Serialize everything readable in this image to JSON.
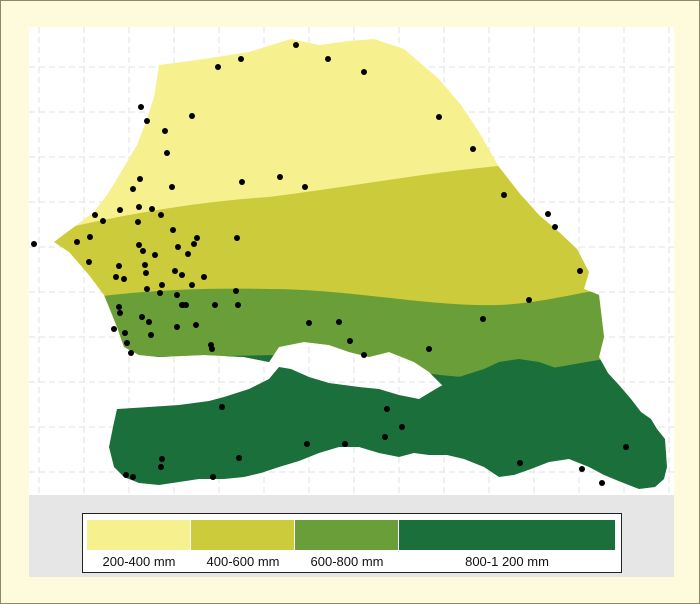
{
  "map": {
    "zones": [
      {
        "id": "zone-200-400",
        "color": "#f7f08f"
      },
      {
        "id": "zone-400-600",
        "color": "#cccb3b"
      },
      {
        "id": "zone-600-800",
        "color": "#6a9e38"
      },
      {
        "id": "zone-800-1200",
        "color": "#1a6f3a"
      }
    ],
    "point_color": "#000000"
  },
  "legend": {
    "items": [
      {
        "label": "200-400 mm",
        "color": "#f7f08f"
      },
      {
        "label": "400-600 mm",
        "color": "#cccb3b"
      },
      {
        "label": "600-800 mm",
        "color": "#6a9e38"
      },
      {
        "label": "800-1 200 mm",
        "color": "#1a6f3a"
      }
    ]
  }
}
